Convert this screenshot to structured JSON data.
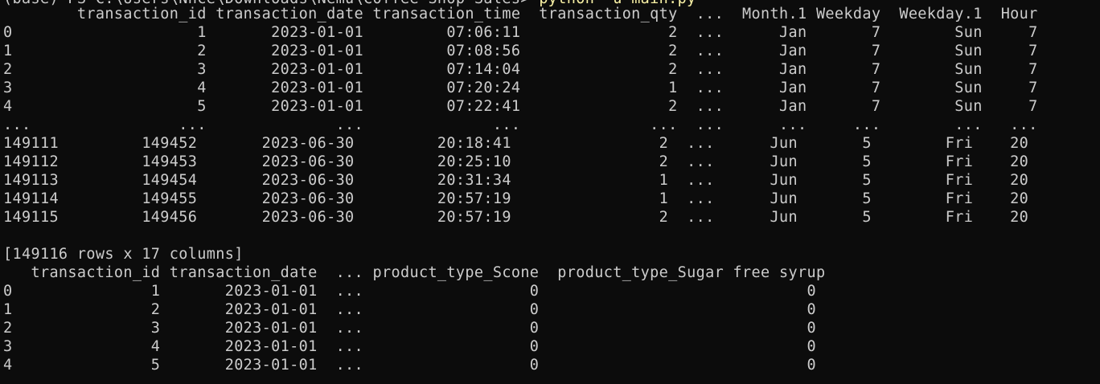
{
  "terminal": {
    "prompt_partial": "(base) PS C:\\Users\\Nhce\\Downloads\\Nemu\\Coffee Shop Sales> ",
    "command_partial": "python -u main.py",
    "lines": [
      "        transaction_id transaction_date transaction_time  transaction_qty  ...  Month.1 Weekday  Weekday.1  Hour",
      "0                    1       2023-01-01         07:06:11                2  ...      Jan       7        Sun     7",
      "1                    2       2023-01-01         07:08:56                2  ...      Jan       7        Sun     7",
      "2                    3       2023-01-01         07:14:04                2  ...      Jan       7        Sun     7",
      "3                    4       2023-01-01         07:20:24                1  ...      Jan       7        Sun     7",
      "4                    5       2023-01-01         07:22:41                2  ...      Jan       7        Sun     7",
      "...                ...              ...              ...              ...  ...      ...     ...        ...   ...",
      "149111         149452       2023-06-30         20:18:41                2  ...      Jun       5        Fri    20",
      "149112         149453       2023-06-30         20:25:10                2  ...      Jun       5        Fri    20",
      "149113         149454       2023-06-30         20:31:34                1  ...      Jun       5        Fri    20",
      "149114         149455       2023-06-30         20:57:19                1  ...      Jun       5        Fri    20",
      "149115         149456       2023-06-30         20:57:19                2  ...      Jun       5        Fri    20",
      "",
      "[149116 rows x 17 columns]",
      "   transaction_id transaction_date  ... product_type_Scone  product_type_Sugar free syrup",
      "0               1       2023-01-01  ...                  0                             0",
      "1               2       2023-01-01  ...                  0                             0",
      "2               3       2023-01-01  ...                  0                             0",
      "3               4       2023-01-01  ...                  0                             0",
      "4               5       2023-01-01  ...                  0                             0"
    ]
  }
}
